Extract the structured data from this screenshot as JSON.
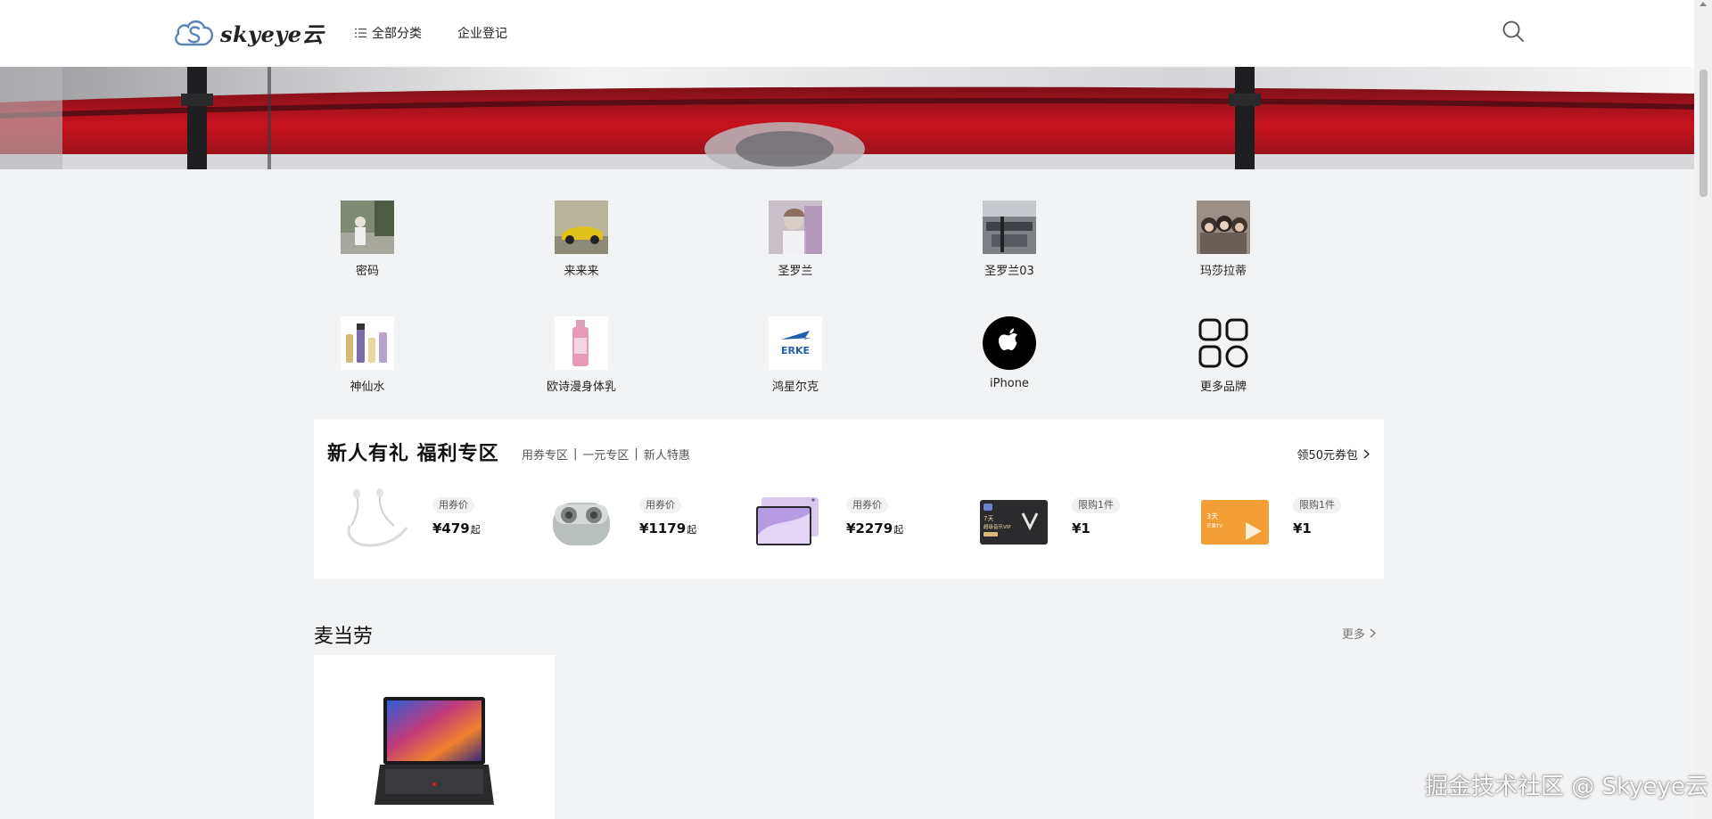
{
  "header": {
    "logo_text": "skyeye云",
    "nav": [
      {
        "label": "全部分类",
        "icon": "list-icon"
      },
      {
        "label": "企业登记"
      }
    ],
    "search_icon": "search-icon"
  },
  "brands": [
    {
      "name": "密码"
    },
    {
      "name": "来来来"
    },
    {
      "name": "圣罗兰"
    },
    {
      "name": "圣罗兰03"
    },
    {
      "name": "玛莎拉蒂"
    },
    {
      "name": "神仙水"
    },
    {
      "name": "欧诗漫身体乳"
    },
    {
      "name": "鸿星尔克",
      "logo_text": "ERKE"
    },
    {
      "name": "iPhone",
      "icon": "apple-logo-icon"
    },
    {
      "name": "更多品牌",
      "icon": "grid-apps-icon"
    }
  ],
  "promo": {
    "title": "新人有礼 福利专区",
    "subs": [
      "用券专区",
      "一元专区",
      "新人特惠"
    ],
    "sep": "|",
    "more_label": "领50元券包",
    "deals": [
      {
        "tag": "用券价",
        "price": "¥479",
        "suffix": "起"
      },
      {
        "tag": "用券价",
        "price": "¥1179",
        "suffix": "起"
      },
      {
        "tag": "用券价",
        "price": "¥2279",
        "suffix": "起"
      },
      {
        "tag": "限购1件",
        "price": "¥1",
        "suffix": "",
        "card_text": [
          "7天",
          "超级音乐VIP"
        ]
      },
      {
        "tag": "限购1件",
        "price": "¥1",
        "suffix": "",
        "card_text": [
          "3天",
          "芒果TV"
        ]
      }
    ]
  },
  "section": {
    "title": "麦当劳",
    "more_label": "更多"
  },
  "watermark": "掘金技术社区 @ Skyeye云",
  "colors": {
    "page_bg": "#f1f3f5",
    "panel_bg": "#ffffff",
    "banner_red": "#c2101f"
  }
}
